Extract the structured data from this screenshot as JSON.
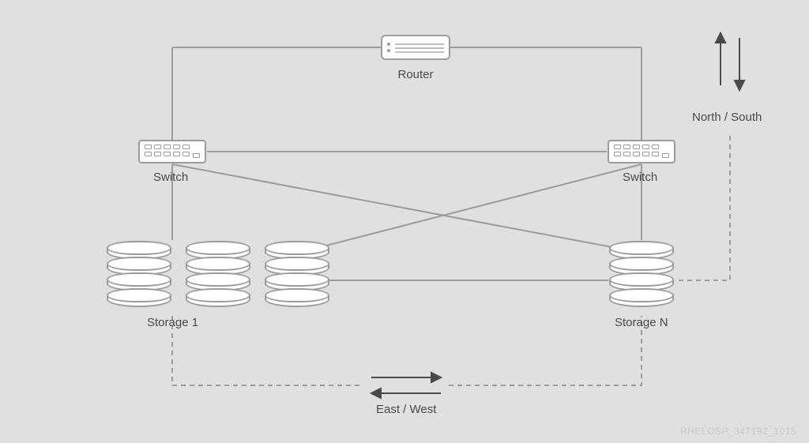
{
  "nodes": {
    "router": {
      "label": "Router"
    },
    "switch_left": {
      "label": "Switch"
    },
    "switch_right": {
      "label": "Switch"
    },
    "storage_left": {
      "label": "Storage 1"
    },
    "storage_right": {
      "label": "Storage N"
    }
  },
  "traffic": {
    "north_south": "North / South",
    "east_west": "East / West"
  },
  "watermark": "RHELOSP_347192_1015"
}
